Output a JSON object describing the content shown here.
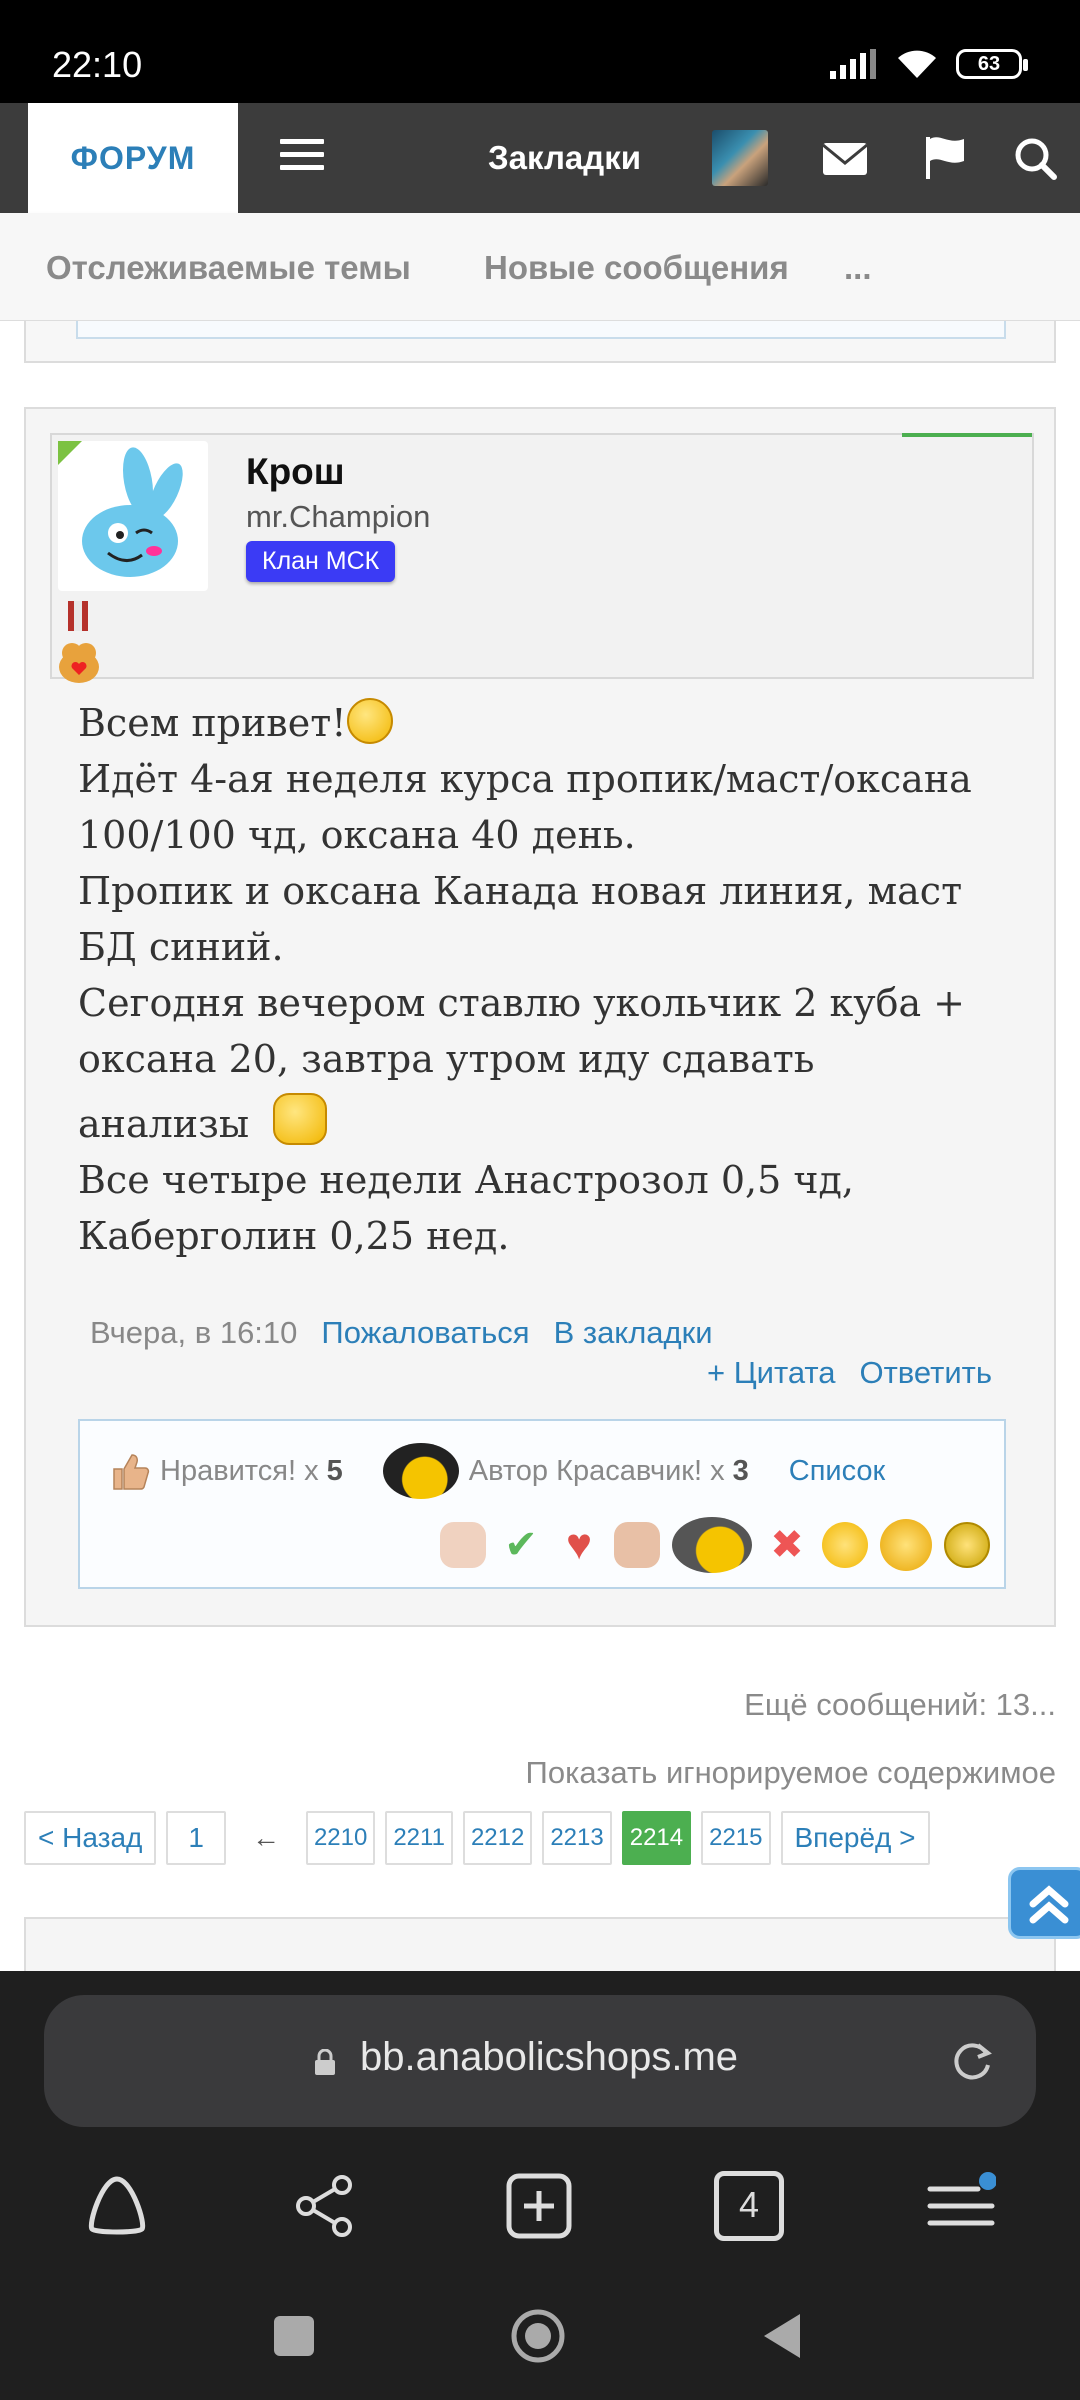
{
  "status": {
    "time": "22:10",
    "battery": "63"
  },
  "nav": {
    "forum": "ФОРУМ",
    "bookmarks": "Закладки"
  },
  "subnav": {
    "tracked": "Отслеживаемые темы",
    "new_messages": "Новые сообщения",
    "more": "..."
  },
  "post": {
    "username": "Крош",
    "user_title": "mr.Champion",
    "clan": "Клан МСК",
    "lines": [
      "Всем привет!",
      "Идёт 4-ая неделя курса пропик/маст/оксана",
      "100/100 чд, оксана 40 день.",
      "Пропик и оксана Канада новая линия, маст",
      "БД синий.",
      "Сегодня вечером ставлю укольчик 2 куба +",
      "оксана 20, завтра утром иду сдавать",
      "анализы",
      "Все четыре недели Анастрозол 0,5 чд,",
      "Каберголин 0,25 нед."
    ],
    "time": "Вчера, в 16:10",
    "report": "Пожаловаться",
    "bookmark": "В закладки",
    "quote": "+ Цитата",
    "reply": "Ответить",
    "likes": {
      "like_label": "Нравится! x",
      "like_count": "5",
      "author_label": "Автор Красавчик! x",
      "author_count": "3",
      "list": "Список"
    }
  },
  "more_messages": "Ещё сообщений: 13...",
  "show_ignored": "Показать игнорируемое содержимое",
  "pager": {
    "prev": "< Назад",
    "first": "1",
    "ellipsis": "←",
    "pages": [
      "2210",
      "2211",
      "2212",
      "2213",
      "2214",
      "2215"
    ],
    "current": "2214",
    "next": "Вперёд >"
  },
  "browser": {
    "url": "bb.anabolicshops.me",
    "tabs": "4"
  },
  "colors": {
    "accent": "#2c7fb8",
    "active_page": "#4caf50",
    "clan_badge": "#3b3bf5"
  }
}
